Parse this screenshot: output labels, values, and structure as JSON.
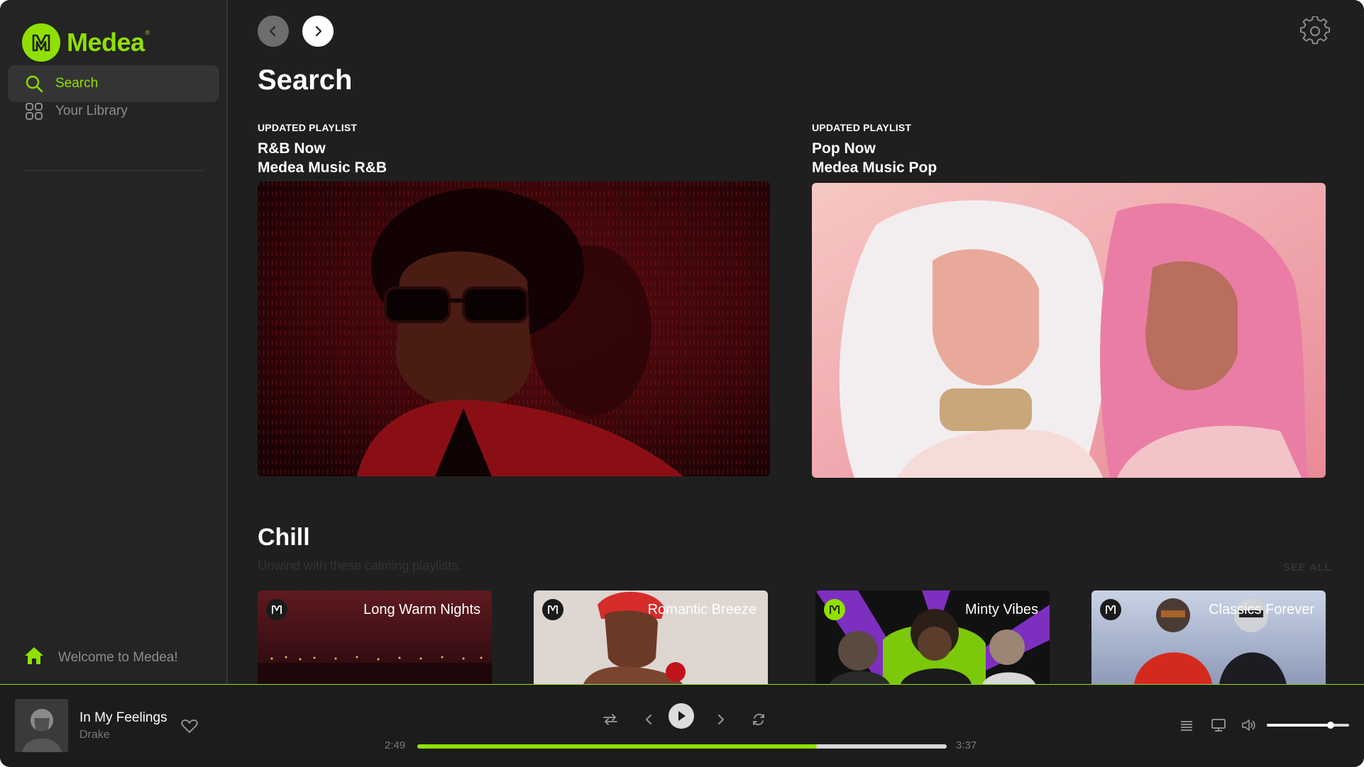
{
  "app": {
    "brand": "Medea",
    "accent_color": "#8fe000"
  },
  "sidebar": {
    "items": [
      {
        "label": "Search",
        "icon": "search-icon",
        "active": true
      },
      {
        "label": "Your Library",
        "icon": "grid-icon",
        "active": false
      }
    ],
    "footer": {
      "label": "Welcome to Medea!",
      "icon": "home-icon"
    }
  },
  "header": {
    "back_icon": "chevron-left-icon",
    "forward_icon": "chevron-right-icon",
    "settings_icon": "gear-icon"
  },
  "main": {
    "title": "Search",
    "featured": [
      {
        "eyebrow": "UPDATED PLAYLIST",
        "title": "R&B Now",
        "subtitle": "Medea Music R&B"
      },
      {
        "eyebrow": "UPDATED PLAYLIST",
        "title": "Pop Now",
        "subtitle": "Medea Music Pop"
      }
    ],
    "section": {
      "title": "Chill",
      "subtitle": "Unwind with these calming playlists.",
      "see_all": "SEE ALL",
      "playlists": [
        {
          "name": "Long Warm Nights"
        },
        {
          "name": "Romantic Breeze"
        },
        {
          "name": "Minty Vibes"
        },
        {
          "name": "Classics Forever"
        }
      ]
    }
  },
  "player": {
    "track_title": "In My Feelings",
    "artist": "Drake",
    "current_time": "2:49",
    "total_time": "3:37",
    "progress_fraction": 0.755,
    "volume_fraction": 0.78,
    "controls": [
      "shuffle-icon",
      "previous-icon",
      "play-icon",
      "next-icon",
      "repeat-icon"
    ],
    "right_controls": [
      "queue-icon",
      "device-icon",
      "volume-icon"
    ]
  }
}
